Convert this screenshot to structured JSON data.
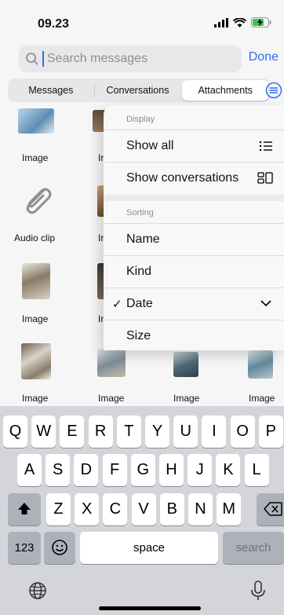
{
  "status_bar": {
    "time": "09.23",
    "icons": [
      "signal-icon",
      "wifi-icon",
      "battery-charging-icon"
    ]
  },
  "search": {
    "placeholder": "Search messages",
    "done_label": "Done"
  },
  "tabs": [
    {
      "label": "Messages",
      "active": false
    },
    {
      "label": "Conversations",
      "active": false
    },
    {
      "label": "Attachments",
      "active": true
    }
  ],
  "grid": {
    "captions": {
      "r1c1": "Image",
      "r1c2": "Ir",
      "r2c1": "Audio clip",
      "r2c2": "Ir",
      "r3c1": "Image",
      "r3c2": "Ir",
      "r4c1": "Image",
      "r4c2": "Image",
      "r4c3": "Image",
      "r4c4": "Image"
    }
  },
  "menu": {
    "display_header": "Display",
    "show_all": "Show all",
    "show_conversations": "Show conversations",
    "sorting_header": "Sorting",
    "name": "Name",
    "kind": "Kind",
    "date": "Date",
    "size": "Size",
    "date_checkmark": "✓"
  },
  "keyboard": {
    "row1": [
      "Q",
      "W",
      "E",
      "R",
      "T",
      "Y",
      "U",
      "I",
      "O",
      "P"
    ],
    "row2": [
      "A",
      "S",
      "D",
      "F",
      "G",
      "H",
      "J",
      "K",
      "L"
    ],
    "row3": [
      "Z",
      "X",
      "C",
      "V",
      "B",
      "N",
      "M"
    ],
    "numbers": "123",
    "space": "space",
    "search": "search"
  }
}
